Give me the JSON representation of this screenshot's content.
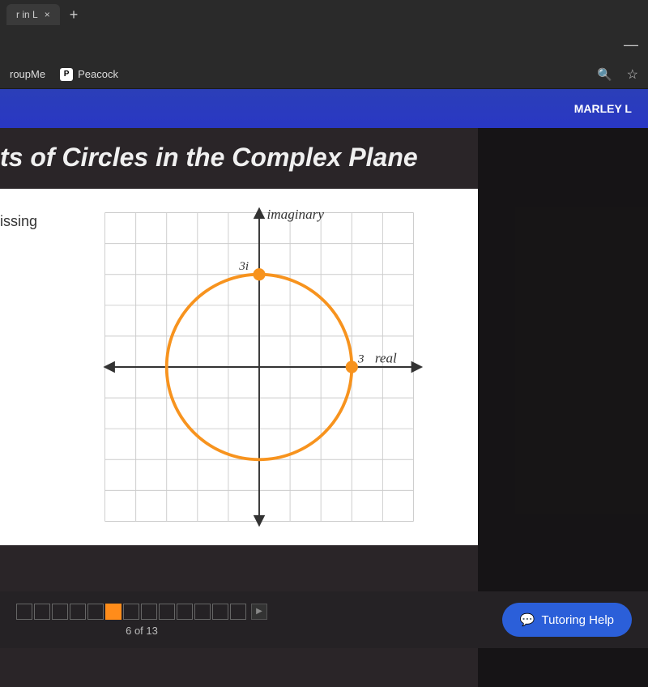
{
  "browser": {
    "tab_title": "r in L",
    "new_tab": "+"
  },
  "bookmarks": {
    "groupme": "roupMe",
    "peacock": "Peacock",
    "peacock_icon": "P"
  },
  "banner": {
    "user": "MARLEY L"
  },
  "lesson": {
    "title": "ts of Circles in the Complex Plane",
    "question": "issing"
  },
  "chart_data": {
    "type": "circle_complex_plane",
    "axis_imaginary_label": "imaginary",
    "axis_real_label": "real",
    "points": [
      {
        "label": "3i",
        "real": 0,
        "imag": 3
      },
      {
        "label": "3",
        "real": 3,
        "imag": 0
      }
    ],
    "circle": {
      "center_real": 0,
      "center_imag": 0,
      "radius": 3
    },
    "grid_range": {
      "xmin": -5,
      "xmax": 5,
      "ymin": -5,
      "ymax": 5
    }
  },
  "footer": {
    "progress_current": 6,
    "progress_total": 13,
    "progress_label": "6 of 13",
    "tutoring": "Tutoring Help"
  }
}
